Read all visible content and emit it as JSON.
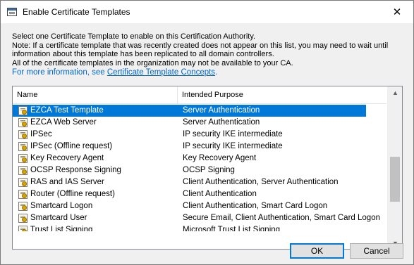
{
  "window": {
    "title": "Enable Certificate Templates",
    "close_glyph": "✕"
  },
  "description": {
    "line1": "Select one Certificate Template to enable on this Certification Authority.",
    "line2": "Note: If a certificate template that was recently created does not appear on this list, you may need to wait until",
    "line3": "information about this template has been replicated to all domain controllers.",
    "line4": "All of the certificate templates in the organization may not be available to your CA.",
    "info_prefix": "For more information, see ",
    "info_link": "Certificate Template Concepts",
    "info_suffix": "."
  },
  "list": {
    "columns": {
      "name": "Name",
      "purpose": "Intended Purpose"
    },
    "rows": [
      {
        "name": "EZCA Test Template",
        "purpose": "Server Authentication",
        "selected": true
      },
      {
        "name": "EZCA Web Server",
        "purpose": "Server Authentication"
      },
      {
        "name": "IPSec",
        "purpose": "IP security IKE intermediate"
      },
      {
        "name": "IPSec (Offline request)",
        "purpose": "IP security IKE intermediate"
      },
      {
        "name": "Key Recovery Agent",
        "purpose": "Key Recovery Agent"
      },
      {
        "name": "OCSP Response Signing",
        "purpose": "OCSP Signing"
      },
      {
        "name": "RAS and IAS Server",
        "purpose": "Client Authentication, Server Authentication"
      },
      {
        "name": "Router (Offline request)",
        "purpose": "Client Authentication"
      },
      {
        "name": "Smartcard Logon",
        "purpose": "Client Authentication, Smart Card Logon"
      },
      {
        "name": "Smartcard User",
        "purpose": "Secure Email, Client Authentication, Smart Card Logon"
      },
      {
        "name": "Trust List Signing",
        "purpose": "Microsoft Trust List Signing"
      }
    ],
    "scroll_up_glyph": "▲",
    "scroll_down_glyph": "▼"
  },
  "buttons": {
    "ok": "OK",
    "cancel": "Cancel"
  },
  "colors": {
    "selection": "#0078d7",
    "link": "#0066cc"
  },
  "icons": {
    "app": "certificate-templates-window-icon",
    "row": "certificate-icon"
  }
}
